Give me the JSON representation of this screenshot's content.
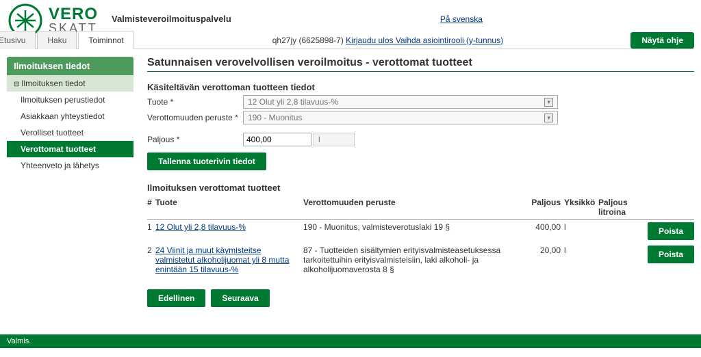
{
  "header": {
    "logo_top": "VERO",
    "logo_bot": "SKATT",
    "service_title": "Valmisteveroilmoituspalvelu",
    "lang_link": "På svenska",
    "user_text": "qh27jy (6625898-7) ",
    "logout_text": "Kirjaudu ulos",
    "role_text": " Vaihda asiointirooli (y-tunnus)",
    "show_help": "Näytä ohje"
  },
  "tabs": [
    {
      "label": "Etusivu",
      "active": false
    },
    {
      "label": "Haku",
      "active": false
    },
    {
      "label": "Toiminnot",
      "active": true
    }
  ],
  "sidebar": {
    "header": "Ilmoituksen tiedot",
    "group": "Ilmoituksen tiedot",
    "items": [
      {
        "label": "Ilmoituksen perustiedot",
        "active": false
      },
      {
        "label": "Asiakkaan yhteystiedot",
        "active": false
      },
      {
        "label": "Verolliset tuotteet",
        "active": false
      },
      {
        "label": "Verottomat tuotteet",
        "active": true
      },
      {
        "label": "Yhteenveto ja lähetys",
        "active": false
      }
    ]
  },
  "main": {
    "page_title": "Satunnaisen verovelvollisen veroilmoitus - verottomat tuotteet",
    "section_title": "Käsiteltävän verottoman tuotteen tiedot",
    "labels": {
      "product": "Tuote *",
      "basis": "Verottomuuden peruste *",
      "amount": "Paljous *"
    },
    "values": {
      "product": "12 Olut yli 2,8 tilavuus-%",
      "basis": "190 - Muonitus",
      "amount": "400,00",
      "unit": "l"
    },
    "save_btn": "Tallenna tuoterivin tiedot",
    "table_title": "Ilmoituksen verottomat tuotteet",
    "columns": {
      "num": "#",
      "product": "Tuote",
      "basis": "Verottomuuden peruste",
      "amount": "Paljous",
      "unit": "Yksikkö",
      "liters": "Paljous litroina"
    },
    "rows": [
      {
        "num": "1",
        "product": "12 Olut yli 2,8 tilavuus-%",
        "basis": "190 - Muonitus, valmisteverotuslaki 19 §",
        "amount": "400,00",
        "unit": "l",
        "delete": "Poista"
      },
      {
        "num": "2",
        "product": "24 Viinit ja muut käymisteitse valmistetut alkoholijuomat yli 8 mutta enintään 15 tilavuus-%",
        "basis": "87 - Tuotteiden sisältymien erityisvalmisteasetuksessa tarkoitettuihin erityisvalmisteisiin, laki alkoholi- ja alkoholijuomaverosta 8 §",
        "amount": "20,00",
        "unit": "l",
        "delete": "Poista"
      }
    ],
    "prev": "Edellinen",
    "next": "Seuraava"
  },
  "footer": {
    "status": "Valmis."
  }
}
